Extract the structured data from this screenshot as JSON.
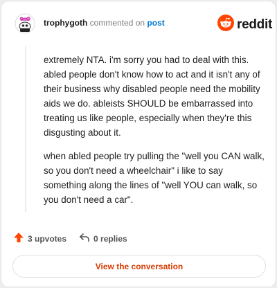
{
  "comment": {
    "author": "trophygoth",
    "action_text": "commented on",
    "target_text": "post",
    "paragraphs": [
      "extremely NTA. i'm sorry you had to deal with this. abled people don't know how to act and it isn't any of their business why disabled people need the mobility aids we do. ableists SHOULD be embarrassed into treating us like people, especially when they're this disgusting about it.",
      "when abled people try pulling the \"well you CAN walk, so you don't need a wheelchair\" i like to say something along the lines of \"well YOU can walk, so you don't need a car\"."
    ]
  },
  "brand": {
    "wordmark": "reddit",
    "color": "#ff4500"
  },
  "stats": {
    "upvotes_label": "3 upvotes",
    "replies_label": "0 replies"
  },
  "cta": {
    "label": "View the conversation"
  },
  "icons": {
    "avatar": "avatar-icon",
    "reddit_logo": "reddit-logo-icon",
    "upvote": "upvote-arrow-icon",
    "reply": "reply-arrow-icon"
  },
  "colors": {
    "accent": "#ff4500",
    "link": "#0079d3",
    "cta_text": "#d93a00"
  }
}
